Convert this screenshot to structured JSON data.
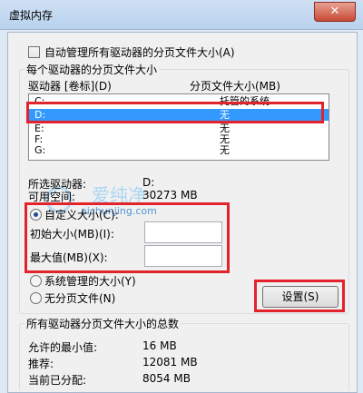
{
  "window": {
    "title": "虚拟内存",
    "close_glyph": "✕"
  },
  "auto_manage": {
    "label": "自动管理所有驱动器的分页文件大小(A)",
    "checked": false
  },
  "paging_group": {
    "legend": "每个驱动器的分页文件大小",
    "columns": {
      "drive": "驱动器 [卷标](D)",
      "size": "分页文件大小(MB)"
    },
    "rows": [
      {
        "drive": "C:",
        "size": "托管的系统",
        "selected": false
      },
      {
        "drive": "D:",
        "size": "无",
        "selected": true
      },
      {
        "drive": "E:",
        "size": "无",
        "selected": false
      },
      {
        "drive": "F:",
        "size": "无",
        "selected": false
      },
      {
        "drive": "G:",
        "size": "无",
        "selected": false
      }
    ],
    "selected_drive_label": "所选驱动器:",
    "selected_drive_value": "D:",
    "free_space_label": "可用空间:",
    "free_space_value": "30273 MB",
    "custom_size_label": "自定义大小(C):",
    "initial_size_label": "初始大小(MB)(I):",
    "initial_size_value": "",
    "max_size_label": "最大值(MB)(X):",
    "max_size_value": "",
    "system_managed_label": "系统管理的大小(Y)",
    "no_paging_label": "无分页文件(N)",
    "selected_option": "custom",
    "set_button": "设置(S)"
  },
  "total_group": {
    "legend": "所有驱动器分页文件大小的总数",
    "min_label": "允许的最小值:",
    "min_value": "16 MB",
    "recommended_label": "推荐:",
    "recommended_value": "12081 MB",
    "allocated_label": "当前已分配:",
    "allocated_value": "8054 MB"
  },
  "watermark": {
    "text": "爱纯净",
    "url": "aichunjing.com"
  },
  "colors": {
    "highlight": "#e3232b",
    "selection": "#3399ff"
  }
}
